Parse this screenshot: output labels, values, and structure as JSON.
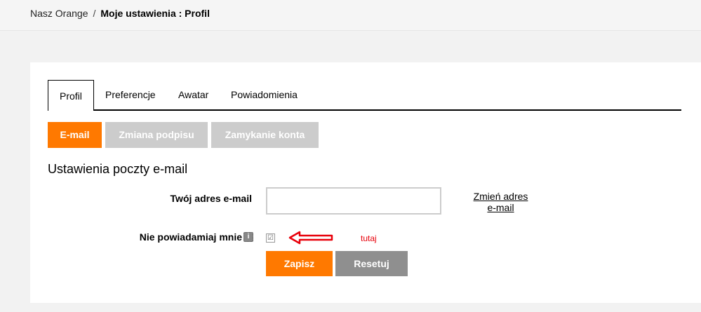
{
  "breadcrumb": {
    "root": "Nasz Orange",
    "separator": "/",
    "current": "Moje ustawienia : Profil"
  },
  "tabs": [
    {
      "label": "Profil",
      "active": true
    },
    {
      "label": "Preferencje",
      "active": false
    },
    {
      "label": "Awatar",
      "active": false
    },
    {
      "label": "Powiadomienia",
      "active": false
    }
  ],
  "subtabs": [
    {
      "label": "E-mail",
      "active": true
    },
    {
      "label": "Zmiana podpisu",
      "active": false
    },
    {
      "label": "Zamykanie konta",
      "active": false
    }
  ],
  "section_title": "Ustawienia poczty e-mail",
  "form": {
    "email_label": "Twój adres e-mail",
    "email_value": "",
    "change_link": "Zmień adres e-mail",
    "notify_label": "Nie powiadamiaj mnie",
    "notify_checked": true,
    "checkbox_mark": "☑",
    "save_label": "Zapisz",
    "reset_label": "Resetuj"
  },
  "annotation": {
    "note": "tutaj",
    "arrow_color": "#e8000a"
  },
  "colors": {
    "accent": "#ff7900",
    "inactive": "#cccccc",
    "reset": "#8f8f8f"
  }
}
